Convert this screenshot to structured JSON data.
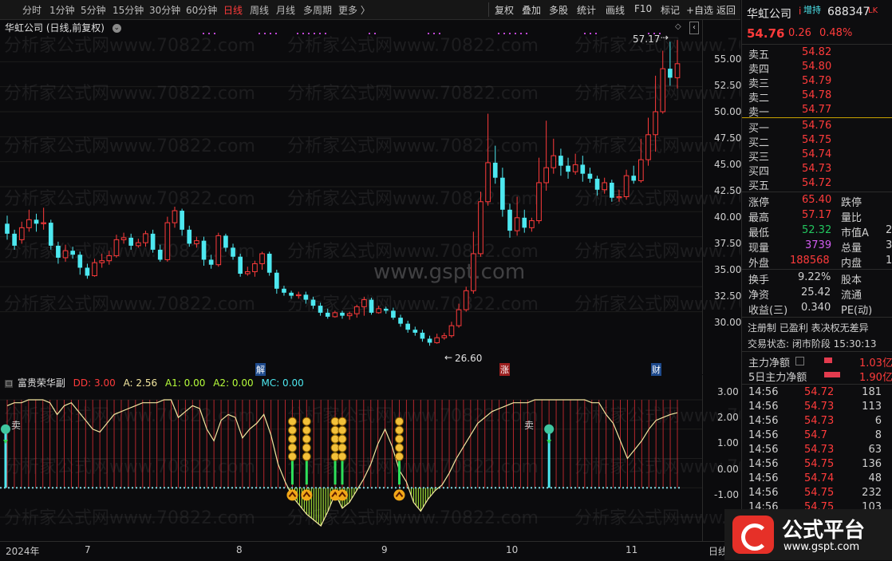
{
  "toolbar": {
    "periods": [
      "分时",
      "1分钟",
      "5分钟",
      "15分钟",
      "30分钟",
      "60分钟",
      "日线",
      "周线",
      "月线",
      "多周期",
      "更多 〉"
    ],
    "active_period": "日线",
    "buttons": [
      "复权",
      "叠加",
      "多股",
      "统计",
      "画线",
      "F10",
      "标记",
      "+自选",
      "返回"
    ]
  },
  "main": {
    "title": "华虹公司 (日线,前复权)",
    "high_label": "57.17",
    "low_label": "26.60",
    "markers": [
      "解",
      "涨",
      "财"
    ],
    "y_ticks": [
      "55.00",
      "52.50",
      "50.00",
      "47.50",
      "45.00",
      "42.50",
      "40.00",
      "37.50",
      "35.00",
      "32.50",
      "30.00"
    ]
  },
  "sub": {
    "title": "富贵荣华副",
    "dd_label": "DD: 3.00",
    "a_label": "A: 2.56",
    "a1_label": "A1: 0.00",
    "a2_label": "A2: 0.00",
    "mc_label": "MC: 0.00",
    "sell_mark": "卖",
    "y_ticks": [
      "3.00",
      "2.00",
      "1.00",
      "0.00",
      "-1.00"
    ]
  },
  "x_axis": [
    "2024年",
    "7",
    "8",
    "9",
    "10",
    "11"
  ],
  "x_axis_right": "日线",
  "watermark": {
    "repeat": "分析家公式网www.70822.com",
    "center": "www.gspt.com"
  },
  "quote": {
    "name": "华虹公司",
    "tag": "增持",
    "code": "688347",
    "mini": "LK",
    "price": "54.76",
    "change": "0.26",
    "pct": "0.48%",
    "asks": [
      {
        "label": "卖五",
        "price": "54.82"
      },
      {
        "label": "卖四",
        "price": "54.80"
      },
      {
        "label": "卖三",
        "price": "54.79"
      },
      {
        "label": "卖二",
        "price": "54.78"
      },
      {
        "label": "卖一",
        "price": "54.77"
      }
    ],
    "bids": [
      {
        "label": "买一",
        "price": "54.76"
      },
      {
        "label": "买二",
        "price": "54.75"
      },
      {
        "label": "买三",
        "price": "54.74"
      },
      {
        "label": "买四",
        "price": "54.73"
      },
      {
        "label": "买五",
        "price": "54.72"
      }
    ],
    "stats": [
      {
        "k": "涨停",
        "v": "65.40",
        "k2": "跌停"
      },
      {
        "k": "最高",
        "v": "57.17",
        "k2": "量比"
      },
      {
        "k": "最低",
        "v": "52.32",
        "k2": "市值A",
        "v2": "2"
      },
      {
        "k": "现量",
        "v": "3739",
        "k2": "总量",
        "v2": "3"
      },
      {
        "k": "外盘",
        "v": "188568",
        "k2": "内盘",
        "v2": "1"
      }
    ],
    "stats2": [
      {
        "k": "换手",
        "v": "9.22%",
        "k2": "股本"
      },
      {
        "k": "净资",
        "v": "25.42",
        "k2": "流通"
      },
      {
        "k": "收益(三)",
        "v": "0.340",
        "k2": "PE(动)"
      }
    ],
    "flags": "注册制 已盈利 表决权无差异",
    "status": "交易状态: 闭市阶段 15:30:13",
    "flow1_label": "主力净额",
    "flow1_value": "1.03亿",
    "flow2_label": "5日主力净额",
    "flow2_value": "1.90亿",
    "ticks": [
      {
        "t": "14:56",
        "p": "54.72",
        "v": "181"
      },
      {
        "t": "14:56",
        "p": "54.73",
        "v": "113"
      },
      {
        "t": "14:56",
        "p": "54.73",
        "v": "6"
      },
      {
        "t": "14:56",
        "p": "54.7",
        "v": "8"
      },
      {
        "t": "14:56",
        "p": "54.73",
        "v": "63"
      },
      {
        "t": "14:56",
        "p": "54.75",
        "v": "136"
      },
      {
        "t": "14:56",
        "p": "54.74",
        "v": "48"
      },
      {
        "t": "14:56",
        "p": "54.75",
        "v": "232"
      },
      {
        "t": "14:56",
        "p": "54.75",
        "v": "103"
      }
    ]
  },
  "brand": {
    "name": "公式平台",
    "url": "www.gspt.com"
  },
  "colors": {
    "up": "#ff3b3b",
    "down": "#4de8f0",
    "indicator_line": "#f3e7a0",
    "indicator_neg": "#b7ff3b"
  },
  "chart_data": {
    "type": "candlestick",
    "y_range": [
      25.5,
      57.5
    ],
    "candles": [
      [
        38.8,
        37.8,
        39.6,
        37.2
      ],
      [
        37.8,
        36.6,
        38.2,
        36.2
      ],
      [
        37.2,
        38.4,
        39.0,
        36.8
      ],
      [
        38.4,
        39.2,
        40.2,
        38.0
      ],
      [
        39.2,
        38.8,
        39.8,
        38.0
      ],
      [
        38.8,
        38.9,
        40.4,
        38.2
      ],
      [
        38.9,
        36.6,
        39.2,
        36.2
      ],
      [
        36.6,
        35.4,
        37.0,
        34.8
      ],
      [
        35.4,
        36.1,
        36.7,
        35.0
      ],
      [
        36.1,
        35.7,
        36.5,
        35.3
      ],
      [
        35.7,
        34.4,
        36.0,
        33.7
      ],
      [
        34.4,
        33.6,
        34.8,
        33.3
      ],
      [
        33.6,
        34.9,
        35.3,
        33.5
      ],
      [
        34.9,
        35.1,
        35.8,
        34.4
      ],
      [
        35.1,
        35.6,
        36.1,
        34.7
      ],
      [
        35.6,
        37.2,
        37.7,
        35.4
      ],
      [
        37.2,
        37.4,
        37.9,
        36.8
      ],
      [
        37.4,
        36.6,
        37.8,
        36.2
      ],
      [
        36.6,
        36.9,
        37.3,
        36.4
      ],
      [
        36.9,
        37.8,
        38.1,
        36.5
      ],
      [
        37.8,
        36.2,
        38.2,
        35.9
      ],
      [
        36.2,
        35.2,
        36.7,
        35.0
      ],
      [
        35.2,
        38.9,
        39.5,
        35.0
      ],
      [
        38.9,
        40.1,
        40.5,
        38.4
      ],
      [
        40.1,
        38.2,
        40.3,
        37.6
      ],
      [
        38.2,
        36.8,
        38.6,
        36.5
      ],
      [
        36.8,
        37.1,
        37.5,
        36.4
      ],
      [
        37.1,
        35.2,
        37.5,
        34.6
      ],
      [
        35.2,
        34.7,
        35.7,
        34.3
      ],
      [
        34.7,
        37.6,
        37.9,
        34.5
      ],
      [
        37.6,
        36.4,
        37.8,
        36.0
      ],
      [
        36.4,
        35.5,
        36.8,
        35.2
      ],
      [
        35.5,
        33.8,
        35.8,
        33.5
      ],
      [
        33.8,
        34.0,
        34.5,
        33.6
      ],
      [
        34.0,
        34.8,
        35.1,
        33.5
      ],
      [
        34.8,
        35.8,
        36.0,
        34.2
      ],
      [
        35.8,
        33.9,
        36.0,
        33.6
      ],
      [
        33.9,
        32.3,
        34.2,
        31.8
      ],
      [
        32.3,
        31.9,
        32.6,
        31.6
      ],
      [
        31.9,
        31.6,
        32.1,
        31.3
      ],
      [
        31.6,
        31.7,
        32.0,
        31.3
      ],
      [
        31.7,
        31.2,
        32.0,
        30.8
      ],
      [
        31.2,
        30.6,
        31.5,
        30.3
      ],
      [
        30.6,
        29.9,
        30.9,
        29.6
      ],
      [
        29.9,
        29.5,
        30.3,
        29.3
      ],
      [
        29.5,
        29.9,
        30.1,
        29.4
      ],
      [
        29.9,
        29.6,
        30.1,
        29.3
      ],
      [
        29.6,
        29.8,
        30.0,
        29.2
      ],
      [
        29.8,
        30.5,
        30.7,
        29.4
      ],
      [
        30.5,
        31.2,
        31.5,
        29.6
      ],
      [
        31.2,
        29.9,
        31.4,
        29.7
      ],
      [
        29.9,
        30.3,
        30.6,
        29.8
      ],
      [
        30.3,
        30.1,
        30.5,
        29.8
      ],
      [
        30.1,
        29.4,
        30.4,
        29.2
      ],
      [
        29.4,
        28.8,
        29.7,
        28.5
      ],
      [
        28.8,
        28.2,
        29.1,
        27.9
      ],
      [
        28.2,
        27.9,
        28.5,
        27.6
      ],
      [
        27.9,
        27.3,
        28.2,
        27.0
      ],
      [
        27.3,
        26.9,
        27.6,
        26.6
      ],
      [
        26.9,
        27.4,
        27.8,
        26.8
      ],
      [
        27.4,
        27.6,
        27.9,
        27.2
      ],
      [
        27.6,
        28.6,
        29.0,
        27.4
      ],
      [
        28.6,
        30.2,
        30.8,
        28.4
      ],
      [
        30.2,
        32.1,
        32.5,
        30.0
      ],
      [
        32.1,
        35.8,
        38.0,
        31.8
      ],
      [
        35.8,
        41.0,
        42.0,
        35.5
      ],
      [
        41.0,
        44.9,
        49.8,
        40.6
      ],
      [
        44.9,
        43.4,
        46.6,
        42.8
      ],
      [
        43.4,
        40.2,
        44.4,
        39.5
      ],
      [
        40.2,
        38.1,
        40.8,
        37.4
      ],
      [
        38.1,
        39.4,
        41.5,
        37.6
      ],
      [
        39.4,
        38.4,
        40.2,
        37.9
      ],
      [
        38.4,
        39.1,
        39.4,
        38.0
      ],
      [
        39.1,
        42.9,
        45.4,
        38.8
      ],
      [
        42.9,
        44.4,
        49.1,
        42.1
      ],
      [
        44.4,
        45.6,
        47.3,
        43.8
      ],
      [
        45.6,
        44.6,
        46.3,
        43.6
      ],
      [
        44.6,
        44.0,
        45.4,
        43.3
      ],
      [
        44.0,
        44.7,
        45.8,
        43.7
      ],
      [
        44.7,
        43.8,
        45.6,
        43.0
      ],
      [
        43.8,
        43.3,
        44.4,
        42.9
      ],
      [
        43.3,
        42.2,
        43.6,
        41.6
      ],
      [
        42.2,
        42.9,
        43.4,
        41.8
      ],
      [
        42.9,
        41.4,
        43.2,
        41.0
      ],
      [
        41.4,
        41.5,
        42.2,
        41.0
      ],
      [
        41.5,
        43.6,
        44.2,
        41.2
      ],
      [
        43.6,
        43.1,
        44.6,
        42.8
      ],
      [
        43.1,
        45.2,
        47.3,
        42.9
      ],
      [
        45.2,
        47.7,
        49.4,
        44.6
      ],
      [
        47.7,
        50.0,
        53.6,
        46.0
      ],
      [
        50.0,
        54.3,
        56.1,
        49.8
      ],
      [
        54.3,
        53.4,
        57.0,
        52.6
      ],
      [
        53.4,
        54.8,
        57.17,
        52.32
      ]
    ],
    "indicator": {
      "name": "富贵荣华副",
      "DD": 3.0,
      "A": 2.56,
      "A1": 0.0,
      "A2": 0.0,
      "MC": 0.0,
      "y_range": [
        -1.6,
        3.3
      ],
      "a_values": [
        2.8,
        2.9,
        2.9,
        3.0,
        3.0,
        3.0,
        2.9,
        2.5,
        2.8,
        2.9,
        2.6,
        2.3,
        2.0,
        1.9,
        2.2,
        2.5,
        2.6,
        2.7,
        2.8,
        2.9,
        2.9,
        2.9,
        3.0,
        3.0,
        2.4,
        2.6,
        2.8,
        2.7,
        2.0,
        1.6,
        2.3,
        2.5,
        2.4,
        1.7,
        2.0,
        2.2,
        2.5,
        1.8,
        0.8,
        0.2,
        -0.3,
        -0.6,
        -0.9,
        -1.1,
        -1.3,
        -0.8,
        -0.2,
        -0.7,
        -0.5,
        -0.1,
        0.3,
        0.8,
        1.5,
        2.0,
        1.4,
        0.6,
        0.2,
        -0.5,
        -0.8,
        -0.4,
        -0.1,
        0.1,
        0.5,
        1.0,
        1.4,
        1.8,
        2.2,
        2.4,
        2.6,
        2.7,
        2.8,
        2.9,
        2.9,
        2.9,
        3.0,
        3.0,
        3.0,
        3.0,
        3.0,
        3.0,
        3.0,
        3.0,
        2.9,
        2.9,
        2.5,
        2.2,
        1.6,
        1.0,
        1.3,
        1.6,
        2.0,
        2.3,
        2.4,
        2.5,
        2.56
      ],
      "signal_columns": [
        40,
        42,
        46,
        47,
        55
      ],
      "sell_columns": [
        0,
        76
      ]
    }
  }
}
